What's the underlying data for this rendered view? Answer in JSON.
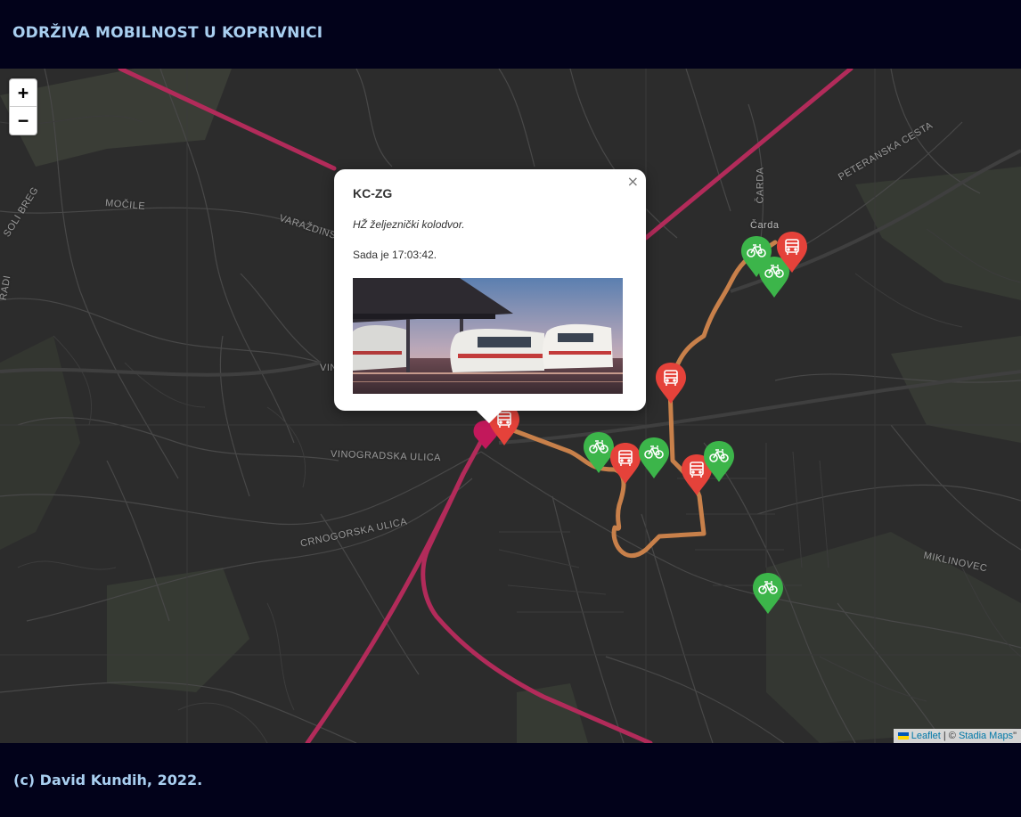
{
  "header": {
    "title": "ODRŽIVA MOBILNOST U KOPRIVNICI"
  },
  "zoom": {
    "in_label": "+",
    "out_label": "−"
  },
  "streets": {
    "mocile": "MOČILE",
    "varazdinska": "VARAŽDINS",
    "breg": "SOLI BREG",
    "vin": "VIN",
    "vinogradska": "VINOGRADSKA ULICA",
    "crnogorska": "CRNOGORSKA ULICA",
    "peteranska": "PETERANSKA CESTA",
    "carda_road": "ČARDA",
    "carda": "Čarda",
    "miklinovec": "MIKLINOVEC",
    "edge": "RADI"
  },
  "popup": {
    "close": "×",
    "title": "KC-ZG",
    "description": "HŽ željeznički kolodvor.",
    "time": "Sada je 17:03:42."
  },
  "markers": [
    {
      "type": "bike",
      "icon": "bicycle-icon"
    },
    {
      "type": "bike",
      "icon": "bicycle-icon"
    },
    {
      "type": "bus",
      "icon": "bus-icon"
    },
    {
      "type": "bus",
      "icon": "bus-icon"
    },
    {
      "type": "bus",
      "icon": "bus-icon"
    },
    {
      "type": "bike",
      "icon": "bicycle-icon"
    },
    {
      "type": "bus",
      "icon": "bus-icon"
    },
    {
      "type": "bike",
      "icon": "bicycle-icon"
    },
    {
      "type": "bus",
      "icon": "bus-icon"
    },
    {
      "type": "bike",
      "icon": "bicycle-icon"
    },
    {
      "type": "bike",
      "icon": "bicycle-icon"
    }
  ],
  "attribution": {
    "leaflet": "Leaflet",
    "sep": " | © ",
    "stadia": "Stadia Maps",
    "tail": "\""
  },
  "colors": {
    "bike": "#3cb54a",
    "bus": "#e5423a",
    "rail": "#b22b5a",
    "bus_route": "#c8804a"
  },
  "footer": {
    "text": "(c) David Kundih, 2022."
  }
}
